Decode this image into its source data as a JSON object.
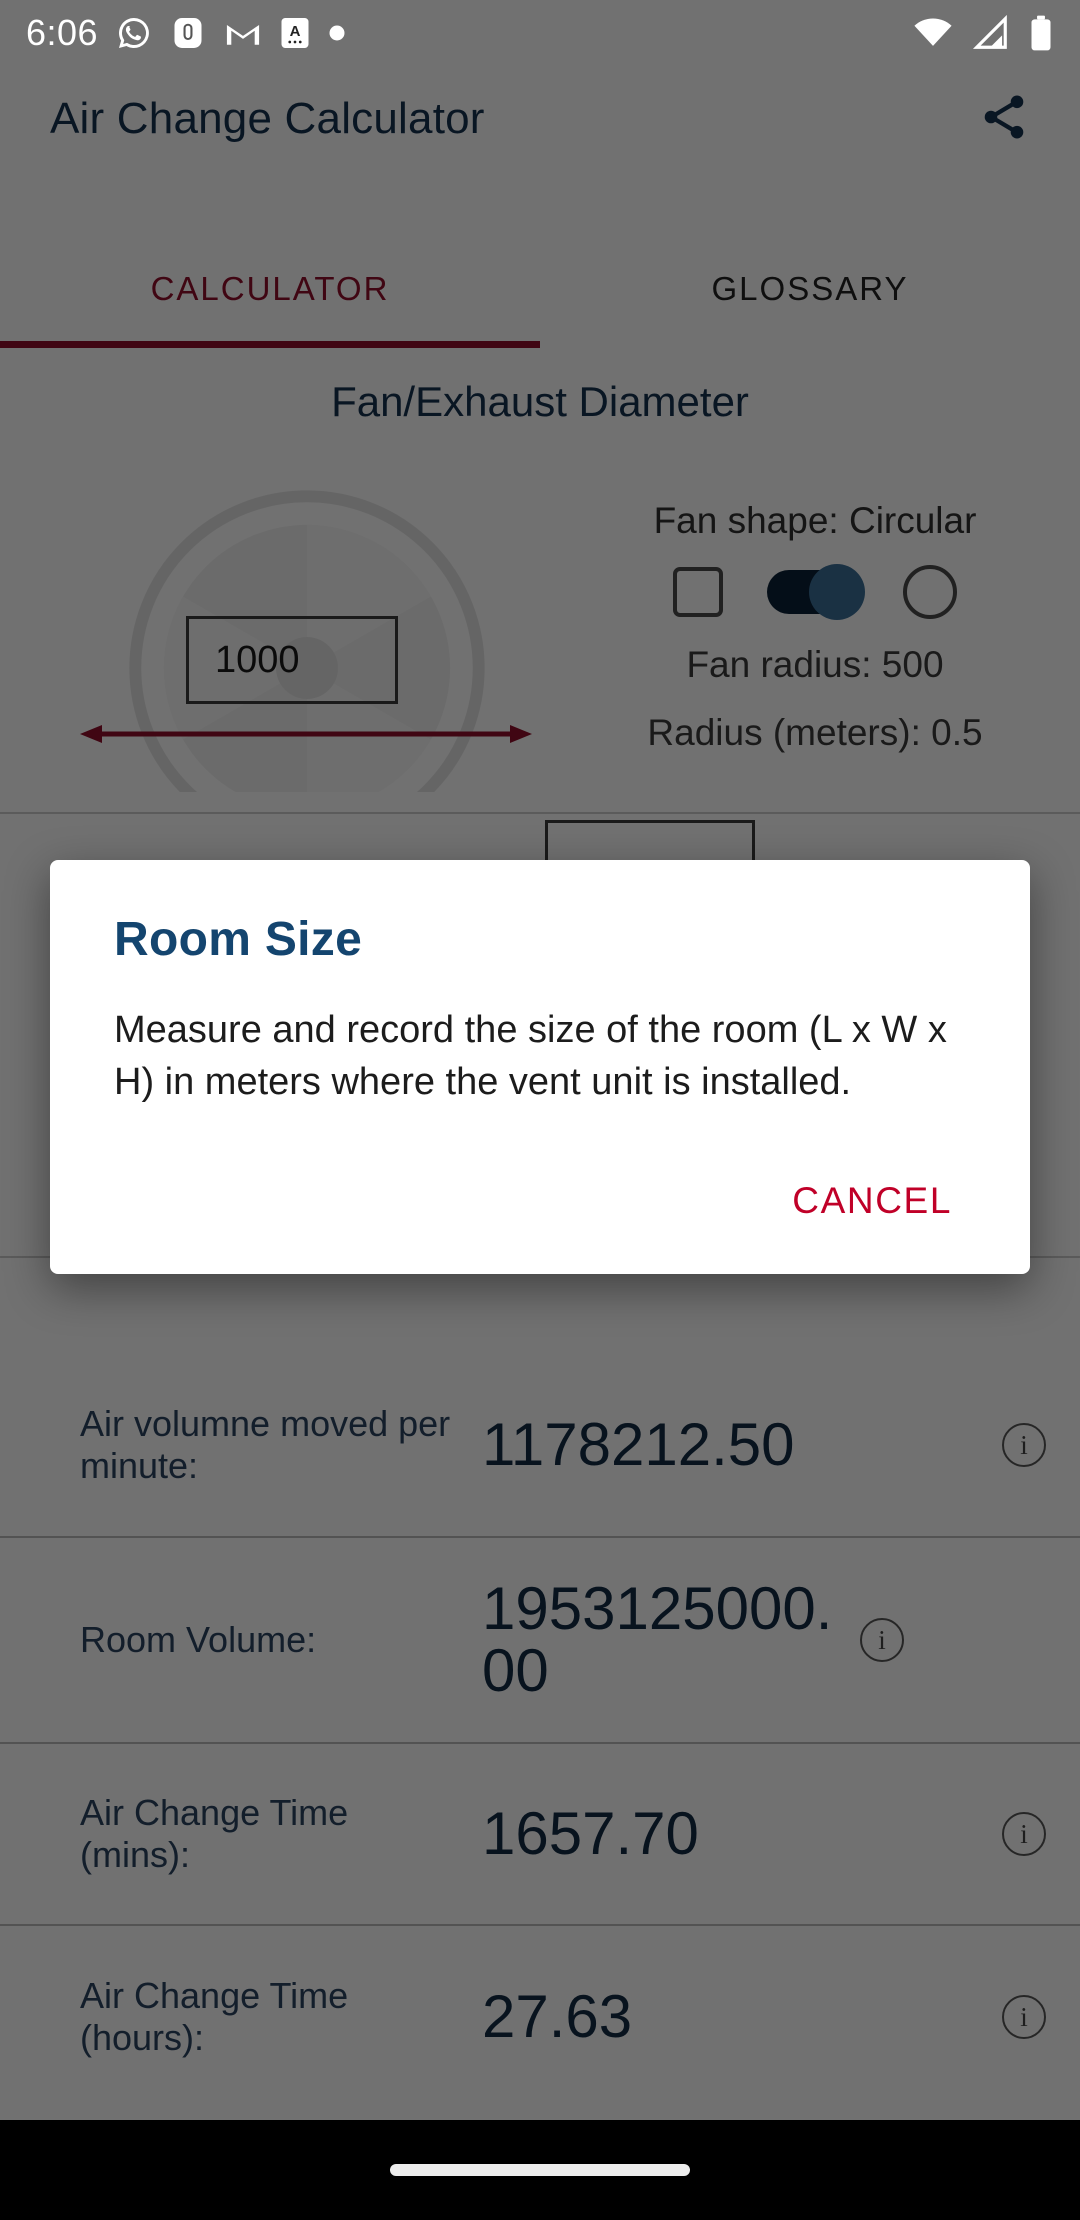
{
  "status_bar": {
    "time": "6:06",
    "left_icons": [
      "whatsapp-icon",
      "u-app-icon",
      "gmail-icon",
      "a-app-icon",
      "dot-icon"
    ],
    "right_icons": [
      "wifi-icon",
      "cell-signal-icon",
      "battery-icon"
    ]
  },
  "app_bar": {
    "title": "Air Change Calculator",
    "share_icon": "share-icon"
  },
  "tabs": [
    {
      "label": "CALCULATOR",
      "active": true
    },
    {
      "label": "GLOSSARY",
      "active": false
    }
  ],
  "fan_section": {
    "title": "Fan/Exhaust Diameter",
    "diameter_value": "1000",
    "shape_label": "Fan shape: Circular",
    "shape_options": [
      "square-shape-icon",
      "shape-toggle-switch",
      "circle-shape-icon"
    ],
    "toggle_state": "on",
    "radius_label": "Fan radius: 500",
    "radius_meters_label": "Radius (meters): 0.5"
  },
  "results": {
    "rows": [
      {
        "label": "Air volumne moved per minute:",
        "value": "1178212.50",
        "info": "i"
      },
      {
        "label": "Room Volume:",
        "value": "1953125000.00",
        "info": "i"
      },
      {
        "label": "Air Change Time (mins):",
        "value": "1657.70",
        "info": "i"
      },
      {
        "label": "Air Change Time (hours):",
        "value": "27.63",
        "info": "i"
      }
    ]
  },
  "dialog": {
    "title": "Room Size",
    "body": "Measure and record the size of the room (L x W x H) in meters where the vent unit is installed.",
    "cancel_label": "CANCEL"
  },
  "colors": {
    "accent_red": "#8f0f2a",
    "cancel_red": "#c00028",
    "navy": "#16314f",
    "dialog_title_blue": "#14456f",
    "toggle_track": "#0b2035",
    "toggle_thumb": "#3a6d96"
  },
  "nav_bar": {
    "pill": "home-indicator"
  }
}
